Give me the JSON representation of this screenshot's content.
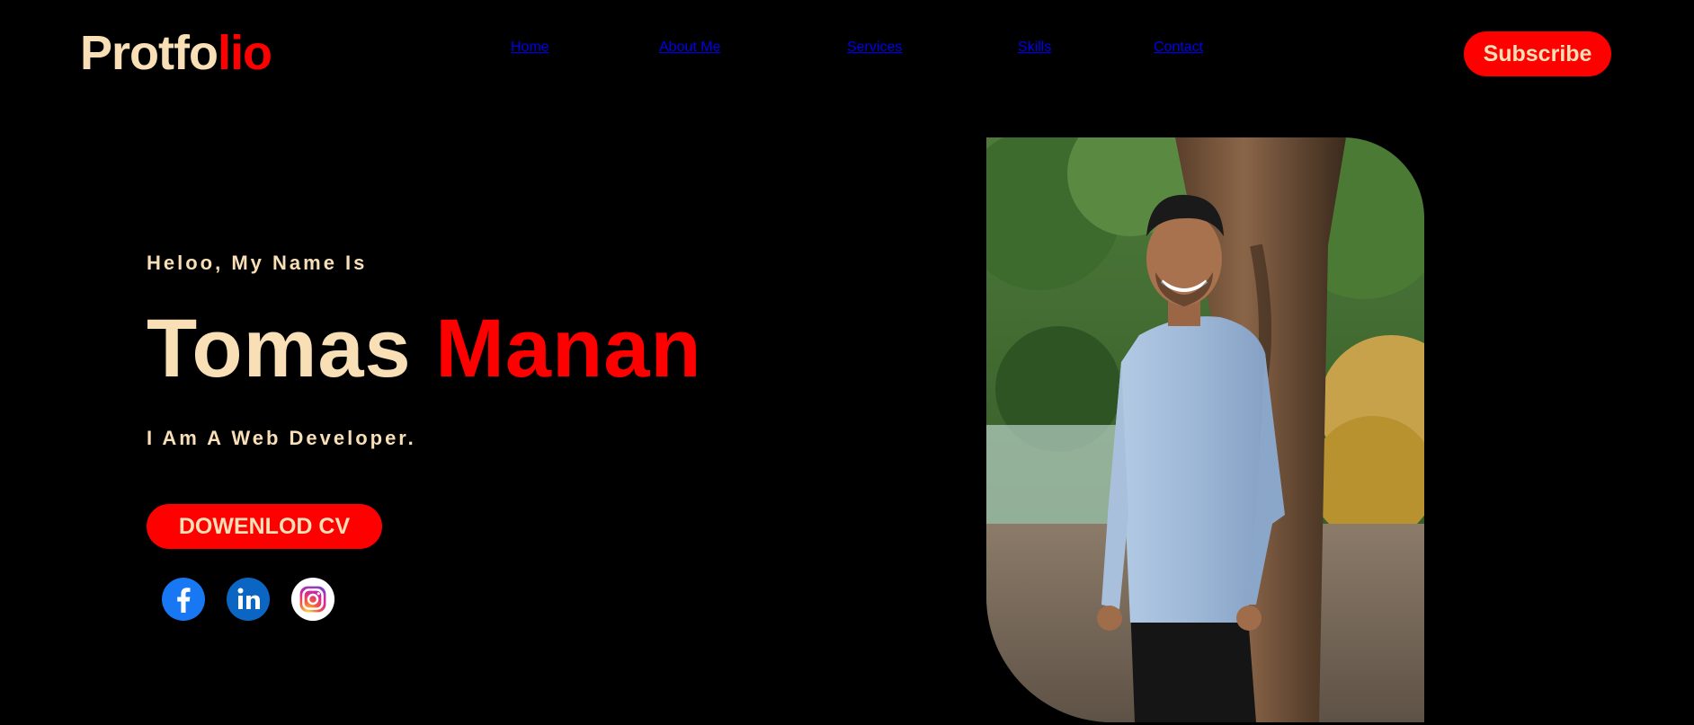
{
  "header": {
    "logo_main": "Protfo",
    "logo_accent": "lio",
    "nav": [
      "Home",
      "About Me",
      "Services",
      "Skills",
      "Contact"
    ],
    "subscribe_label": "Subscribe"
  },
  "hero": {
    "greeting": "Heloo, My Name Is",
    "first_name": "Tomas",
    "last_name": "Manan",
    "role": "I Am A Web Developer.",
    "cv_label": "DOWENLOD CV",
    "social_icons": [
      "facebook-icon",
      "linkedin-icon",
      "instagram-icon"
    ]
  },
  "colors": {
    "background": "#000000",
    "cream": "#f8dfb6",
    "accent_red": "#ff0000"
  }
}
